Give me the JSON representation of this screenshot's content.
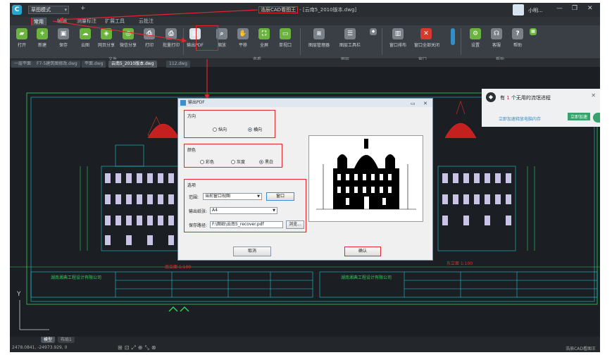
{
  "app": {
    "mode_select": "草图模式",
    "title_highlight": "浩辰CAD看图王",
    "title_file": "云南5_2010版本.dwg",
    "user_name": "小明...",
    "controls": [
      "—",
      "❐",
      "✕"
    ]
  },
  "menu_tabs": [
    "常用",
    "编辑",
    "测量标注",
    "扩展工具",
    "云批注"
  ],
  "ribbon": {
    "buttons": [
      {
        "label": "打开",
        "icon": "folder-open-icon"
      },
      {
        "label": "新建",
        "icon": "new-file-icon"
      },
      {
        "label": "保存",
        "icon": "save-icon"
      },
      {
        "label": "云图",
        "icon": "cloud-icon"
      },
      {
        "label": "网页分享",
        "icon": "web-share-icon"
      },
      {
        "label": "微信分享",
        "icon": "wechat-share-icon"
      },
      {
        "label": "打印",
        "icon": "print-icon"
      },
      {
        "label": "批量打印",
        "icon": "batch-print-icon"
      },
      {
        "label": "输出PDF",
        "icon": "export-pdf-icon"
      },
      {
        "label": "缩放",
        "icon": "zoom-icon"
      },
      {
        "label": "平移",
        "icon": "pan-hand-icon"
      },
      {
        "label": "全屏",
        "icon": "fullscreen-icon"
      },
      {
        "label": "单视口",
        "icon": "single-viewport-icon"
      },
      {
        "label": "图层管理器",
        "icon": "layer-manager-icon"
      },
      {
        "label": "图层工具栏",
        "icon": "layer-toolbar-icon"
      },
      {
        "label": "窗口排布",
        "icon": "window-arrange-icon"
      },
      {
        "label": "窗口全部关闭",
        "icon": "close-all-windows-icon"
      },
      {
        "label": "设置",
        "icon": "settings-icon"
      },
      {
        "label": "客服",
        "icon": "headset-icon"
      },
      {
        "label": "帮助",
        "icon": "help-icon"
      }
    ],
    "groups": [
      "文件",
      "查看",
      "图层",
      "窗口",
      "帮助"
    ]
  },
  "doc_tabs": [
    "一层平面",
    "F7-5建筑图修改.dwg",
    "平面.dwg",
    "云南5_2010版本.dwg",
    "112.dwg"
  ],
  "drawing_labels": {
    "left_red": "南立面 1:100",
    "right_red": "东立面 1:100",
    "company": "湖南湘典工程设计有限公司"
  },
  "status": {
    "coords": "2478.0841, -24973.929, 0",
    "layout_tabs": [
      "模型",
      "布局1"
    ],
    "brand": "浩辰CAD看图王"
  },
  "notification": {
    "title_prefix": "有",
    "count": "1",
    "title_suffix": "个无用的流氓进程",
    "link": "立即加速释放电脑内存",
    "button": "立即加速"
  },
  "dialog": {
    "title": "输出PDF",
    "orientation": {
      "label": "方向",
      "options": [
        "纵向",
        "横向"
      ],
      "selected": 1
    },
    "color": {
      "label": "颜色",
      "options": [
        "彩色",
        "灰度",
        "黑白"
      ],
      "selected": 2
    },
    "options": {
      "label": "选项",
      "range_label": "范围:",
      "range_value": "当前窗口视图",
      "window_button": "窗口",
      "paper_label": "输出纸张:",
      "paper_value": "A4",
      "path_label": "保存路径:",
      "path_value": "F:\\图纸\\云南5_recover.pdf",
      "browse_button": "浏览..."
    },
    "cancel": "取消",
    "confirm": "确认"
  },
  "colors": {
    "highlight": "#e2262d",
    "cad_green": "#2fd15a",
    "cad_red": "#e23030",
    "cad_cyan": "#20c8d8"
  }
}
